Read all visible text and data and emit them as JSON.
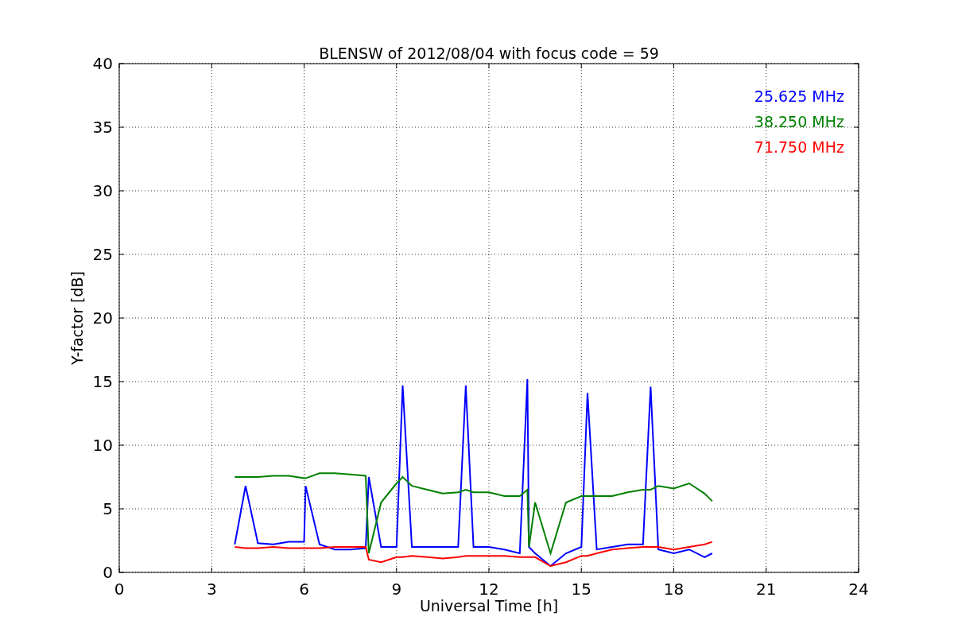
{
  "chart_data": {
    "type": "line",
    "title": "BLENSW of 2012/08/04 with focus code = 59",
    "xlabel": "Universal Time [h]",
    "ylabel": "Y-factor [dB]",
    "x": [
      3.75,
      4.1,
      4.5,
      5,
      5.5,
      6,
      6.05,
      6.5,
      7,
      7.5,
      8,
      8.1,
      8.5,
      9,
      9.2,
      9.5,
      10,
      10.5,
      11,
      11.25,
      11.5,
      12,
      12.5,
      13,
      13.25,
      13.3,
      13.5,
      14,
      14.5,
      15,
      15.2,
      15.5,
      16,
      16.5,
      17,
      17.25,
      17.5,
      18,
      18.5,
      19,
      19.25
    ],
    "series": [
      {
        "name": "25.625 MHz",
        "color": "#0000ff",
        "values": [
          2.2,
          6.8,
          2.3,
          2.2,
          2.4,
          2.4,
          6.8,
          2.2,
          1.8,
          1.8,
          1.9,
          7.5,
          2.0,
          2.0,
          14.7,
          2.0,
          2.0,
          2.0,
          2.0,
          14.7,
          2.0,
          2.0,
          1.8,
          1.5,
          15.2,
          2.0,
          1.5,
          0.5,
          1.5,
          2.0,
          14.1,
          1.8,
          2.0,
          2.2,
          2.2,
          14.6,
          1.8,
          1.5,
          1.8,
          1.2,
          1.5
        ]
      },
      {
        "name": "38.250 MHz",
        "color": "#008000",
        "values": [
          7.5,
          7.5,
          7.5,
          7.6,
          7.6,
          7.4,
          7.4,
          7.8,
          7.8,
          7.7,
          7.6,
          1.5,
          5.5,
          7.0,
          7.5,
          6.8,
          6.5,
          6.2,
          6.3,
          6.5,
          6.3,
          6.3,
          6.0,
          6.0,
          6.5,
          2.0,
          5.5,
          1.5,
          5.5,
          6.0,
          6.0,
          6.0,
          6.0,
          6.3,
          6.5,
          6.5,
          6.8,
          6.6,
          7.0,
          6.2,
          5.6
        ]
      },
      {
        "name": "71.750 MHz",
        "color": "#ff0000",
        "values": [
          2.0,
          1.9,
          1.9,
          2.0,
          1.9,
          1.9,
          1.9,
          1.9,
          2.0,
          2.0,
          2.0,
          1.0,
          0.8,
          1.2,
          1.2,
          1.3,
          1.2,
          1.1,
          1.2,
          1.3,
          1.3,
          1.3,
          1.3,
          1.2,
          1.2,
          1.2,
          1.2,
          0.5,
          0.8,
          1.3,
          1.3,
          1.5,
          1.8,
          1.9,
          2.0,
          2.0,
          2.0,
          1.8,
          2.0,
          2.2,
          2.4
        ]
      }
    ],
    "grid": true,
    "xlim": [
      0,
      24
    ],
    "ylim": [
      0,
      40
    ],
    "xticks": [
      0,
      3,
      6,
      9,
      12,
      15,
      18,
      21,
      24
    ],
    "yticks": [
      0,
      5,
      10,
      15,
      20,
      25,
      30,
      35,
      40
    ]
  }
}
